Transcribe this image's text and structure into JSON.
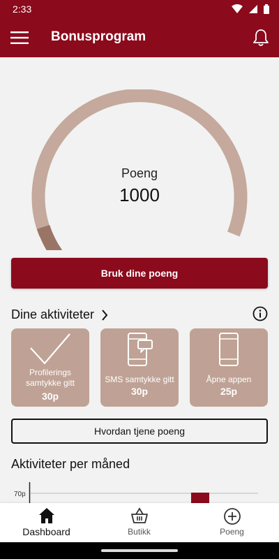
{
  "status_bar": {
    "time": "2:33"
  },
  "app_bar": {
    "title": "Bonusprogram"
  },
  "points": {
    "label": "Poeng",
    "value": "1000",
    "gauge_fraction": 0.1
  },
  "actions": {
    "use_points_label": "Bruk dine poeng",
    "how_to_earn_label": "Hvordan tjene poeng"
  },
  "activities": {
    "title": "Dine aktiviteter",
    "cards": [
      {
        "icon": "checkmark-icon",
        "label": "Profilerings samtykke gitt",
        "points": "30p"
      },
      {
        "icon": "sms-phone-icon",
        "label": "SMS samtykke gitt",
        "points": "30p"
      },
      {
        "icon": "phone-icon",
        "label": "Åpne appen",
        "points": "25p"
      }
    ]
  },
  "chart_section": {
    "title": "Aktiviteter per måned"
  },
  "chart_data": {
    "type": "bar",
    "ytick_labels": [
      "70p"
    ],
    "values": [
      70
    ],
    "ylim": [
      0,
      70
    ]
  },
  "bottom_nav": {
    "items": [
      {
        "label": "Dashboard",
        "icon": "home-icon",
        "active": true
      },
      {
        "label": "Butikk",
        "icon": "basket-icon",
        "active": false
      },
      {
        "label": "Poeng",
        "icon": "plus-circle-icon",
        "active": false
      }
    ]
  },
  "colors": {
    "primary": "#8b0a1c",
    "card": "#bfa295",
    "gauge_track": "#c4a99c",
    "gauge_fill": "#9a7566",
    "background": "#f2f2f2"
  }
}
